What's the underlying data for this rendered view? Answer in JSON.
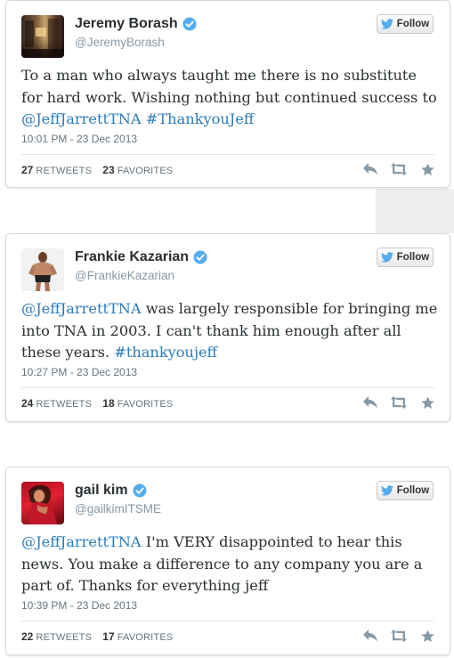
{
  "tweets": [
    {
      "name": "Jeremy Borash",
      "handle": "@JeremyBorash",
      "follow_label": "Follow",
      "text_parts": [
        "To a man who always taught me there is no substitute for hard work. Wishing nothing but continued success to ",
        "@JeffJarrettTNA",
        " ",
        "#ThankyouJeff"
      ],
      "timestamp": "10:01 PM - 23 Dec 2013",
      "retweets": "27",
      "retweets_label": "RETWEETS",
      "favorites": "23",
      "favorites_label": "FAVORITES"
    },
    {
      "name": "Frankie Kazarian",
      "handle": "@FrankieKazarian",
      "follow_label": "Follow",
      "text_parts": [
        "@JeffJarrettTNA",
        "  was largely responsible for bringing me into TNA in 2003. I can't thank him enough after all these years. ",
        "#thankyoujeff"
      ],
      "timestamp": "10:27 PM - 23 Dec 2013",
      "retweets": "24",
      "retweets_label": "RETWEETS",
      "favorites": "18",
      "favorites_label": "FAVORITES"
    },
    {
      "name": "gail kim",
      "handle": "@gailkimITSME",
      "follow_label": "Follow",
      "text_parts": [
        "@JeffJarrettTNA",
        " I'm VERY disappointed to hear this news. You make a difference to any company you are a part of.  Thanks for everything jeff"
      ],
      "timestamp": "10:39 PM - 23 Dec 2013",
      "retweets": "22",
      "retweets_label": "RETWEETS",
      "favorites": "17",
      "favorites_label": "FAVORITES"
    }
  ],
  "colors": {
    "link": "#2b7bb9",
    "verified": "#55acee",
    "twitter_bird": "#55acee",
    "text": "#292f33",
    "muted": "#8899a6",
    "action_icons": "#8899a6"
  },
  "icons": {
    "verified": "verified-badge-icon",
    "bird": "twitter-bird-icon",
    "reply": "reply-icon",
    "retweet": "retweet-icon",
    "favorite": "star-icon"
  }
}
